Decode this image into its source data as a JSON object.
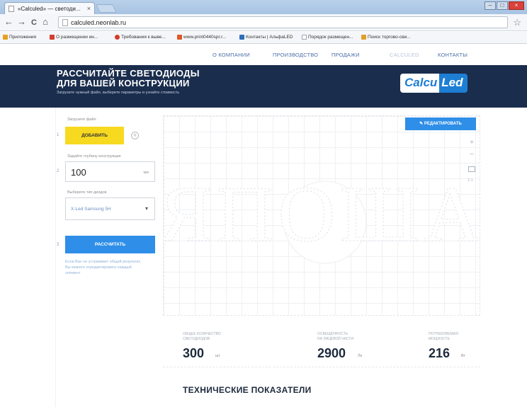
{
  "browser": {
    "tab_title": "«Calculed» — светоди...",
    "tab_close": "×",
    "url": "calculed.neonlab.ru",
    "window_buttons": [
      "–",
      "□",
      "×"
    ],
    "nav": {
      "back": "←",
      "forward": "→",
      "reload": "C",
      "home": "⌂"
    },
    "star": "☆",
    "bookmarks": [
      {
        "label": "Приложения",
        "color": "#e8a020"
      },
      {
        "label": "О размещении ин...",
        "color": "#d53b2c"
      },
      {
        "label": "Требования к выве...",
        "color": "#d53b2c"
      },
      {
        "label": "www.print0440spr.r...",
        "color": "#e0572a"
      },
      {
        "label": "Контакты | АльфаLED",
        "color": "#2d6fb8"
      },
      {
        "label": "Порядок размещен...",
        "color": "#9aa4b0"
      },
      {
        "label": "Поиск торгово-сви...",
        "color": "#e0a02a"
      }
    ]
  },
  "site": {
    "menu": [
      "О КОМПАНИИ",
      "ПРОИЗВОДСТВО",
      "ПРОДАЖИ",
      "CALCULED",
      "КОНТАКТЫ"
    ],
    "hero": {
      "title_line1": "РАССЧИТАЙТЕ СВЕТОДИОДЫ",
      "title_line2": "ДЛЯ ВАШЕЙ КОНСТРУКЦИИ",
      "subtitle": "Загрузите нужный файл, выберите параметры и узнайте стоимость",
      "logo_part1": "Calcu",
      "logo_part2": "Led"
    },
    "form": {
      "upload_label": "Загрузите файл",
      "step1": "1",
      "upload_button": "ДОБАВИТЬ",
      "plus": "+",
      "depth_label": "Задайте глубину конструкции",
      "step2": "2",
      "depth_value": "100",
      "depth_unit": "мм",
      "diode_label": "Выберите тип диодов",
      "diode_value": "X-Led Samsung 5H",
      "select_arrow": "▾",
      "step3": "3",
      "calc_button": "РАССЧИТАТЬ",
      "note": "Если Вас не устраивает общий результат, Вы можете отредактировать каждый элемент"
    },
    "editor": {
      "edit_button": "✎ РЕДАКТИРОВАТЬ",
      "zoom_in": "+",
      "zoom_out": "−",
      "zoom_ratio": "1:1",
      "preview_text": "ЯПОША"
    },
    "stats": [
      {
        "label1": "ОБЩЕЕ КОЛИЧЕСТВО",
        "label2": "СВЕТОДИОДОВ",
        "value": "300",
        "unit": "шт"
      },
      {
        "label1": "ОСВЕЩЁННОСТЬ",
        "label2": "НА ЛИЦЕВОЙ ЧАСТИ",
        "value": "2900",
        "unit": "Лк"
      },
      {
        "label1": "ПОТРЕБЛЯЕМАЯ",
        "label2": "МОЩНОСТЬ",
        "value": "216",
        "unit": "Вт"
      }
    ],
    "tech_title": "ТЕХНИЧЕСКИЕ ПОКАЗАТЕЛИ"
  },
  "colors": {
    "hero_bg": "#1a2d4d",
    "accent_blue": "#2e8ee8",
    "accent_yellow": "#f7d91f"
  }
}
